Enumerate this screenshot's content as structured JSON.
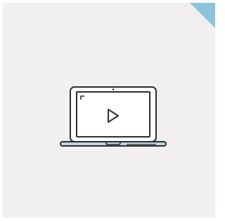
{
  "colors": {
    "background": "#ffffff",
    "card": "#f1efef",
    "outline": "#2d2d2d",
    "screen": "#ffffff",
    "base": "#bcd3e4",
    "corner_accent": "#8ec3dc"
  },
  "icons": {
    "laptop": "laptop-icon",
    "play": "play-icon",
    "corner": "page-corner-icon"
  }
}
